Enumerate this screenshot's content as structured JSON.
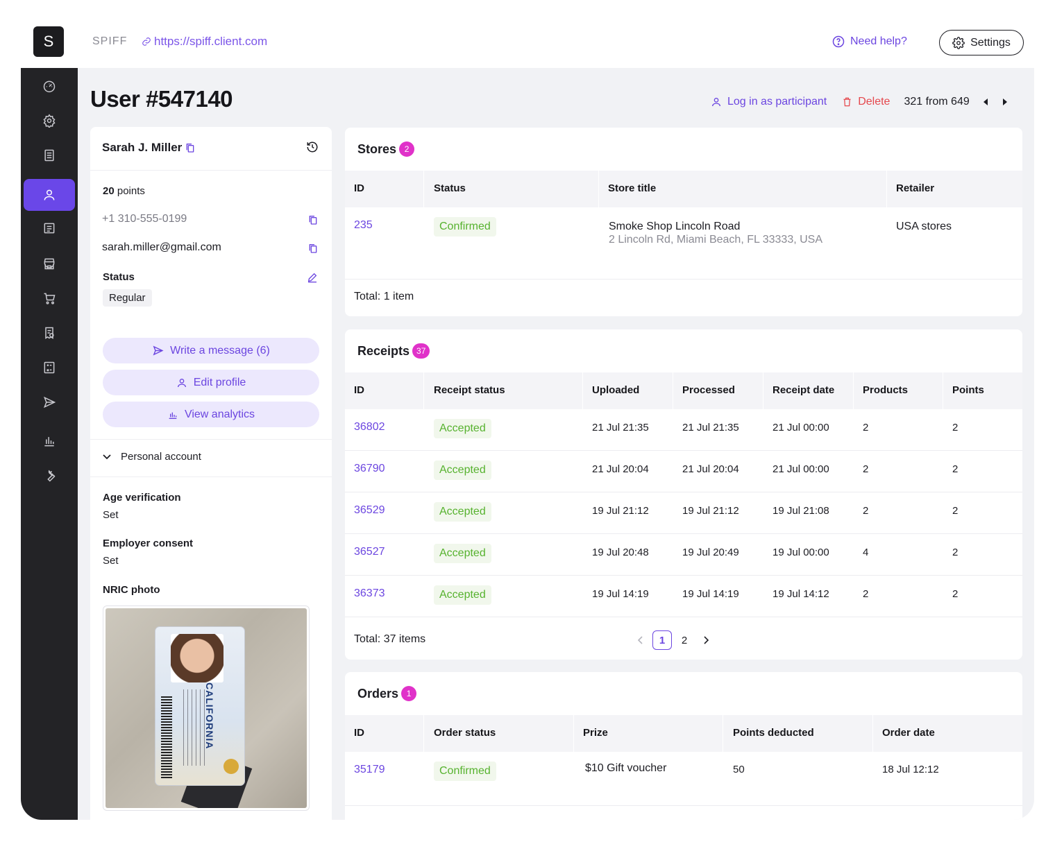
{
  "app": {
    "logo_letter": "S",
    "brand": "SPIFF",
    "url": "https://spiff.client.com",
    "help_label": "Need help?",
    "settings_label": "Settings"
  },
  "sidebar": {
    "items": [
      {
        "icon": "dashboard-icon"
      },
      {
        "icon": "gear-icon"
      },
      {
        "icon": "document-list-icon"
      },
      {
        "icon": "user-icon",
        "active": true
      },
      {
        "icon": "list-icon"
      },
      {
        "icon": "store-icon"
      },
      {
        "icon": "cart-icon"
      },
      {
        "icon": "receipt-check-icon"
      },
      {
        "icon": "calculator-icon"
      },
      {
        "icon": "send-icon"
      },
      {
        "icon": "bar-chart-icon"
      },
      {
        "icon": "wrench-icon"
      }
    ]
  },
  "header": {
    "title": "User #547140",
    "login_label": "Log in as participant",
    "delete_label": "Delete",
    "position": "321 from 649"
  },
  "profile": {
    "name": "Sarah J. Miller",
    "points_value": "20",
    "points_label": "points",
    "phone": "+1 310-555-0199",
    "email": "sarah.miller@gmail.com",
    "status_label": "Status",
    "status_value": "Regular",
    "write_message": "Write a message (6)",
    "edit_profile": "Edit profile",
    "view_analytics": "View analytics",
    "account_label": "Personal account",
    "age_label": "Age verification",
    "age_value": "Set",
    "employer_label": "Employer consent",
    "employer_value": "Set",
    "nric_label": "NRIC photo",
    "nric_card_title": "CALIFORNIA"
  },
  "stores": {
    "title": "Stores",
    "count": "2",
    "columns": [
      "ID",
      "Status",
      "Store title",
      "Retailer"
    ],
    "rows": [
      {
        "id": "235",
        "status": "Confirmed",
        "title": "Smoke Shop Lincoln Road",
        "address": "2 Lincoln Rd, Miami Beach, FL 33333, USA",
        "retailer": "USA stores"
      }
    ],
    "total": "Total: 1 item"
  },
  "receipts": {
    "title": "Receipts",
    "count": "37",
    "columns": [
      "ID",
      "Receipt status",
      "Uploaded",
      "Processed",
      "Receipt date",
      "Products",
      "Points"
    ],
    "rows": [
      {
        "id": "36802",
        "status": "Accepted",
        "uploaded": "21 Jul 21:35",
        "processed": "21 Jul 21:35",
        "date": "21 Jul 00:00",
        "products": "2",
        "points": "2"
      },
      {
        "id": "36790",
        "status": "Accepted",
        "uploaded": "21 Jul 20:04",
        "processed": "21 Jul 20:04",
        "date": "21 Jul 00:00",
        "products": "2",
        "points": "2"
      },
      {
        "id": "36529",
        "status": "Accepted",
        "uploaded": "19 Jul 21:12",
        "processed": "19 Jul 21:12",
        "date": "19 Jul 21:08",
        "products": "2",
        "points": "2"
      },
      {
        "id": "36527",
        "status": "Accepted",
        "uploaded": "19 Jul 20:48",
        "processed": "19 Jul 20:49",
        "date": "19 Jul 00:00",
        "products": "4",
        "points": "2"
      },
      {
        "id": "36373",
        "status": "Accepted",
        "uploaded": "19 Jul 14:19",
        "processed": "19 Jul 14:19",
        "date": "19 Jul 14:12",
        "products": "2",
        "points": "2"
      }
    ],
    "total": "Total: 37 items",
    "pages": [
      "1",
      "2"
    ],
    "current_page": "1"
  },
  "orders": {
    "title": "Orders",
    "count": "1",
    "columns": [
      "ID",
      "Order status",
      "Prize",
      "Points deducted",
      "Order date"
    ],
    "rows": [
      {
        "id": "35179",
        "status": "Confirmed",
        "prize": "$10 Gift voucher",
        "points": "50",
        "date": "18 Jul 12:12"
      }
    ]
  },
  "colors": {
    "accent": "#6b45e0",
    "sidebar_bg": "#232326",
    "badge": "#e032c9",
    "success": "#56b22e",
    "danger": "#e5484d"
  }
}
